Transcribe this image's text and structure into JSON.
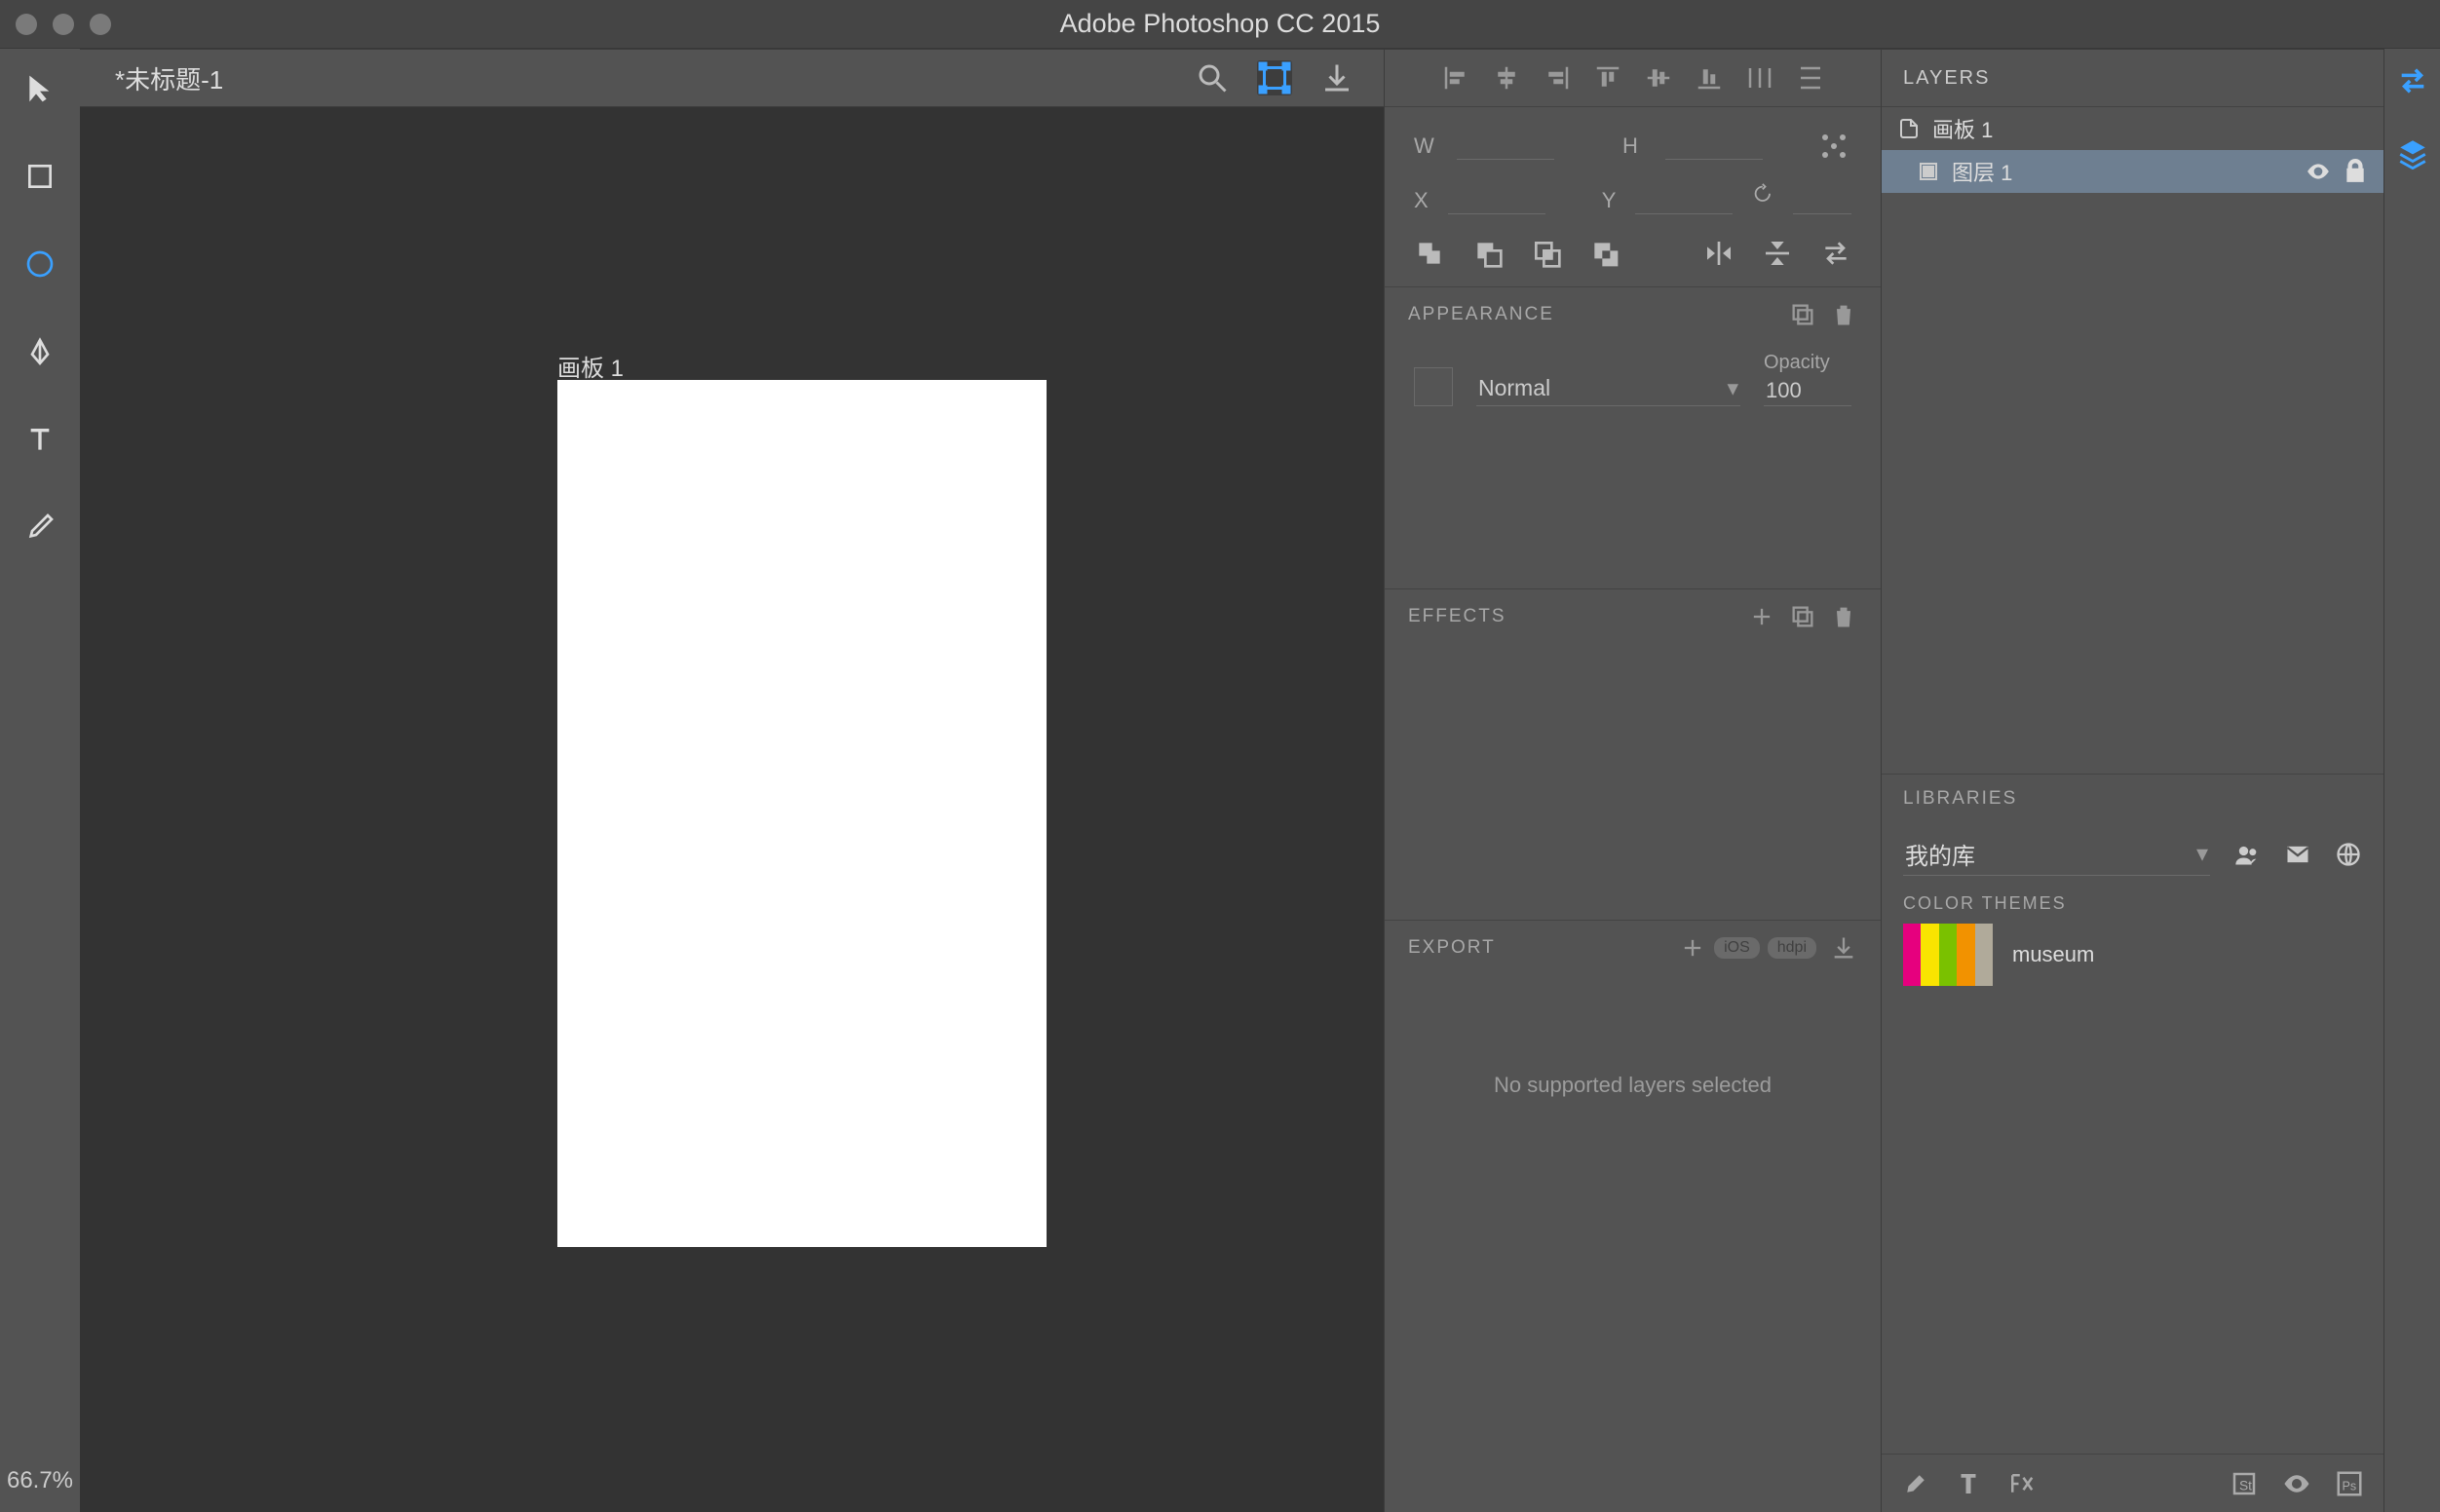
{
  "app_title": "Adobe Photoshop CC 2015",
  "document": {
    "tab_title": "*未标题-1",
    "zoom": "66.7%"
  },
  "artboard": {
    "label": "画板 1"
  },
  "transform": {
    "w_label": "W",
    "h_label": "H",
    "x_label": "X",
    "y_label": "Y",
    "w": "",
    "h": "",
    "x": "",
    "y": ""
  },
  "appearance": {
    "title": "APPEARANCE",
    "blend_mode": "Normal",
    "opacity_label": "Opacity",
    "opacity": "100"
  },
  "effects": {
    "title": "EFFECTS"
  },
  "export": {
    "title": "EXPORT",
    "ios_tag": "iOS",
    "hdpi_tag": "hdpi",
    "empty_msg": "No supported layers selected"
  },
  "layers_panel": {
    "title": "LAYERS",
    "rows": [
      {
        "name": "画板 1",
        "type": "artboard"
      },
      {
        "name": "图层 1",
        "type": "layer"
      }
    ]
  },
  "libraries": {
    "title": "LIBRARIES",
    "selected": "我的库",
    "color_themes_label": "COLOR THEMES",
    "theme_name": "museum",
    "theme_colors": [
      "#e6007e",
      "#f9e400",
      "#7ac100",
      "#f29200",
      "#b0aa9a"
    ]
  }
}
